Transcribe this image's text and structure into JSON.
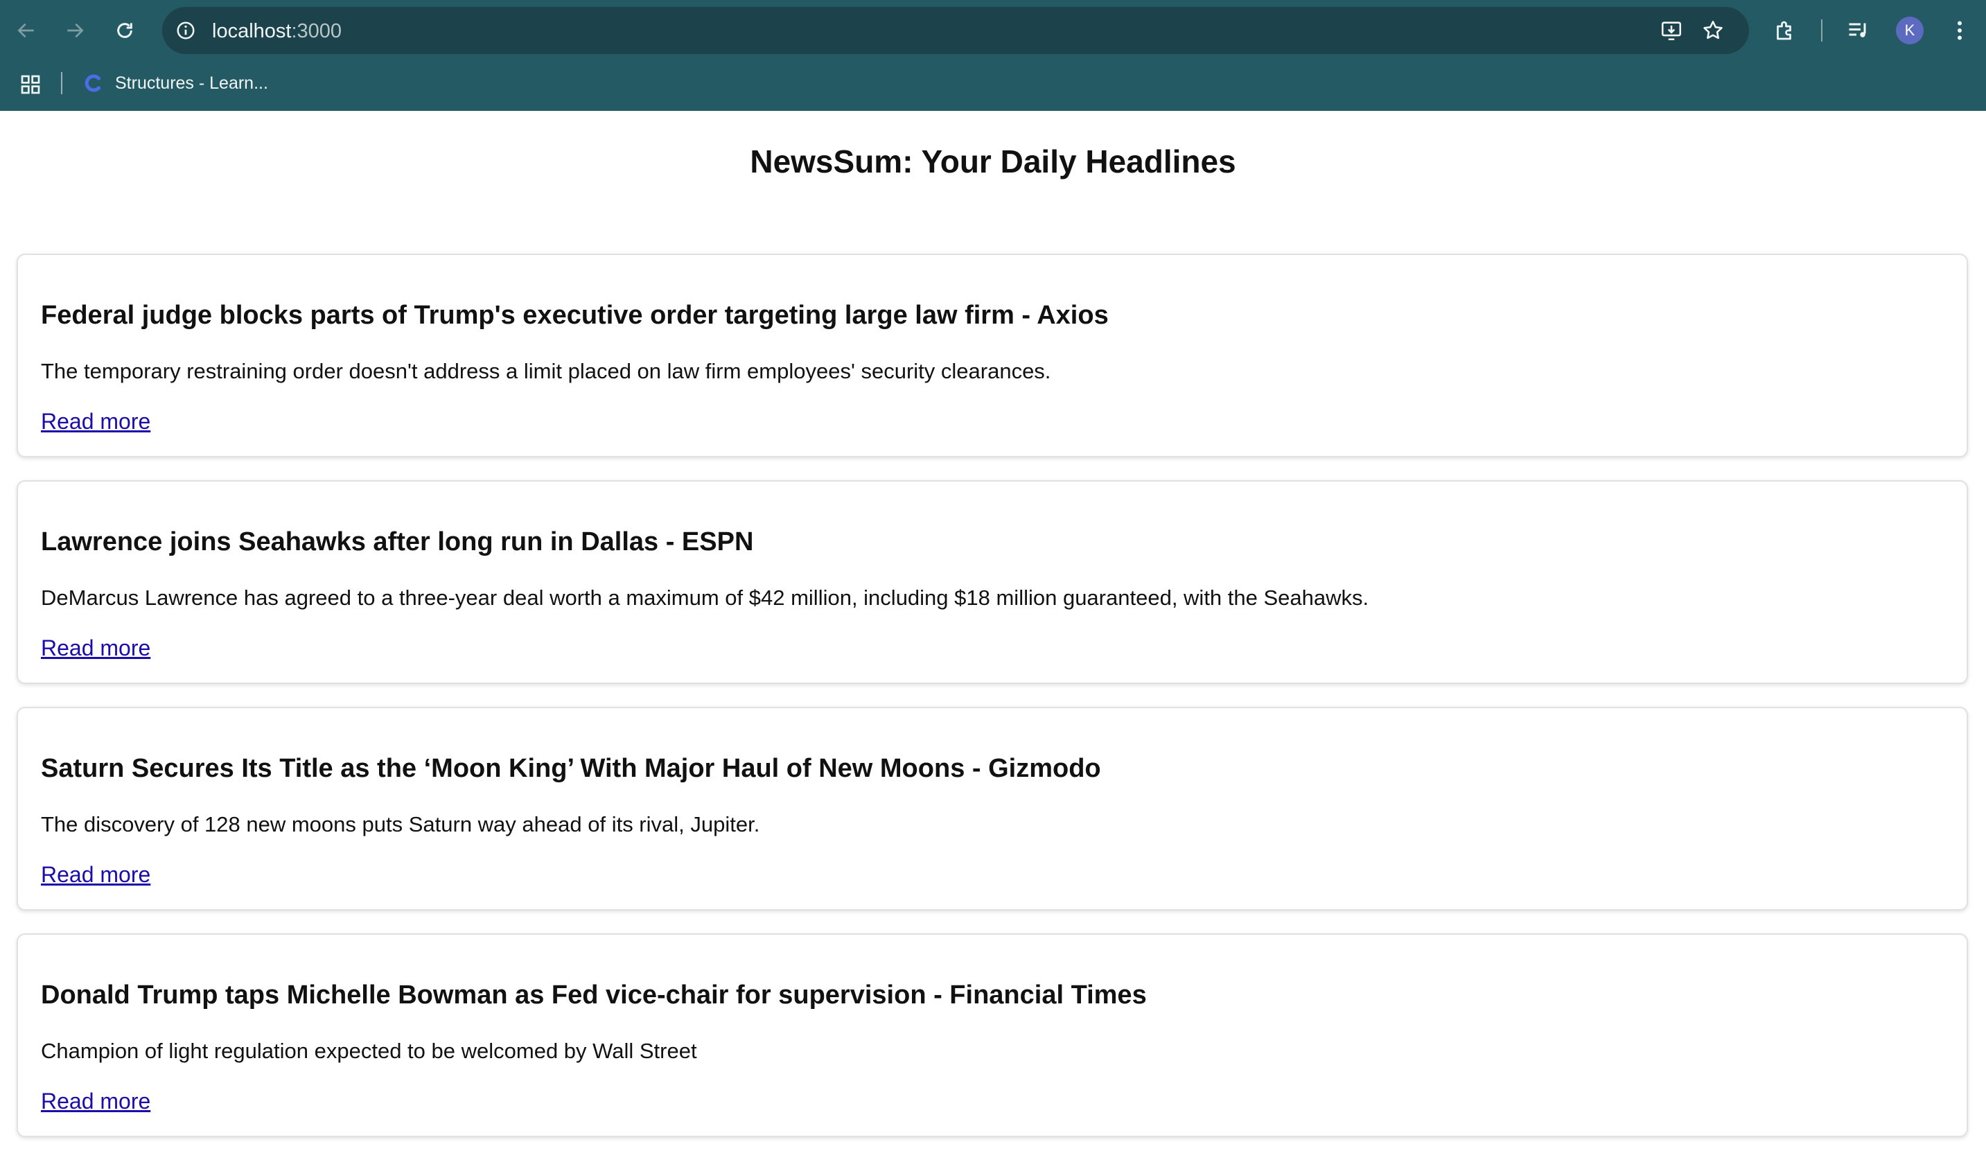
{
  "browser": {
    "url_host": "localhost",
    "url_port": ":3000",
    "profile_initial": "K",
    "bookmark_label": "Structures - Learn...",
    "chrome_color": "#235a64"
  },
  "page": {
    "title": "NewsSum: Your Daily Headlines"
  },
  "articles": [
    {
      "title": "Federal judge blocks parts of Trump's executive order targeting large law firm - Axios",
      "description": "The temporary restraining order doesn't address a limit placed on law firm employees' security clearances.",
      "link_label": "Read more"
    },
    {
      "title": "Lawrence joins Seahawks after long run in Dallas - ESPN",
      "description": "DeMarcus Lawrence has agreed to a three-year deal worth a maximum of $42 million, including $18 million guaranteed, with the Seahawks.",
      "link_label": "Read more"
    },
    {
      "title": "Saturn Secures Its Title as the ‘Moon King’ With Major Haul of New Moons - Gizmodo",
      "description": "The discovery of 128 new moons puts Saturn way ahead of its rival, Jupiter.",
      "link_label": "Read more"
    },
    {
      "title": "Donald Trump taps Michelle Bowman as Fed vice-chair for supervision - Financial Times",
      "description": "Champion of light regulation expected to be welcomed by Wall Street",
      "link_label": "Read more"
    }
  ],
  "icons": {
    "back": "back-arrow-icon",
    "forward": "forward-arrow-icon",
    "reload": "reload-icon",
    "site_info": "info-icon",
    "install": "install-app-icon",
    "bookmark_star": "star-icon",
    "extensions": "puzzle-icon",
    "media": "media-controls-icon",
    "menu": "more-vert-icon",
    "apps": "apps-grid-icon",
    "favicon": "c-logo-icon"
  }
}
